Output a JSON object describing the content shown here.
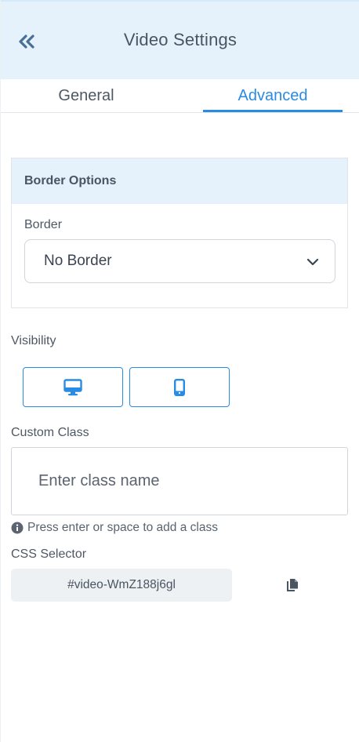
{
  "header": {
    "title": "Video Settings",
    "back_icon": "double-chevron-left-icon"
  },
  "tabs": [
    {
      "label": "General",
      "active": false
    },
    {
      "label": "Advanced",
      "active": true
    }
  ],
  "border_options": {
    "title": "Border Options",
    "field_label": "Border",
    "selected": "No Border",
    "chevron_icon": "chevron-down-icon"
  },
  "visibility": {
    "label": "Visibility",
    "buttons": [
      {
        "icon": "desktop-icon"
      },
      {
        "icon": "mobile-icon"
      }
    ]
  },
  "custom_class": {
    "label": "Custom Class",
    "placeholder": "Enter class name",
    "value": "",
    "hint": "Press enter or space to add a class",
    "hint_icon": "info-icon"
  },
  "css_selector": {
    "label": "CSS Selector",
    "value": "#video-WmZ188j6gl",
    "copy_icon": "copy-icon"
  },
  "colors": {
    "accent": "#2a8be3",
    "header_bg": "#e5f2fc",
    "text": "#4a5562",
    "selector_bg": "#eef1f4"
  }
}
